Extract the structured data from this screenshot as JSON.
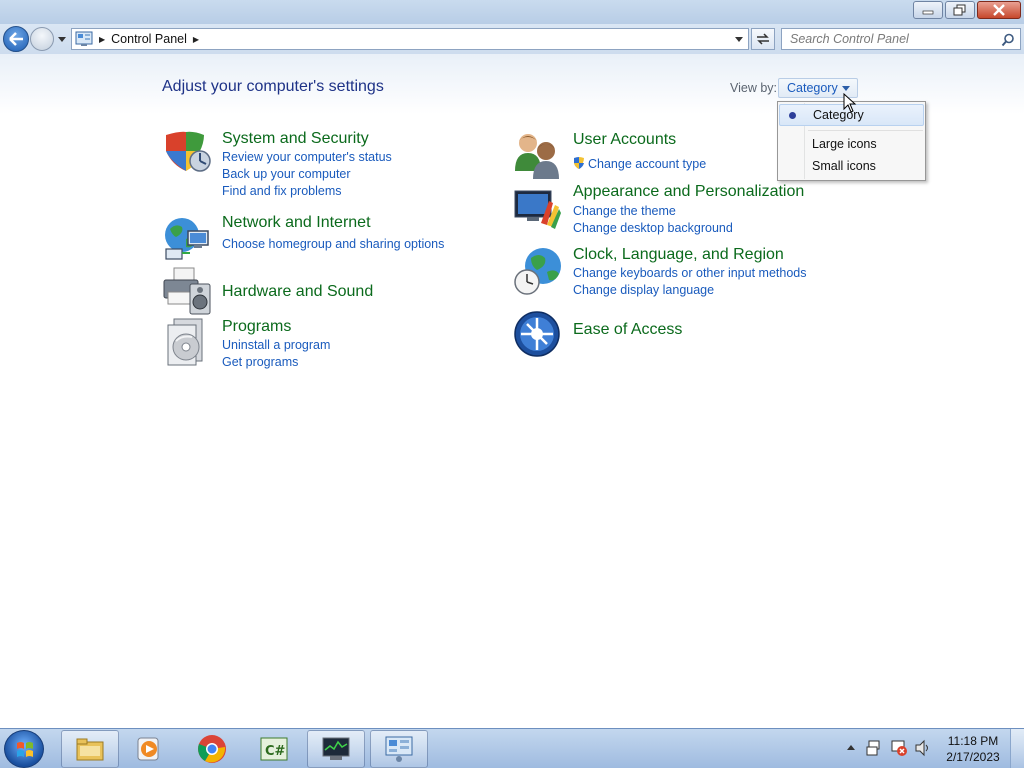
{
  "window": {
    "buttons": [
      "minimize",
      "restore",
      "close"
    ]
  },
  "address": {
    "breadcrumb": "Control Panel",
    "search_placeholder": "Search Control Panel"
  },
  "main": {
    "title": "Adjust your computer's settings",
    "view_by_label": "View by:",
    "view_by_value": "Category"
  },
  "categories": [
    {
      "title": "System and Security",
      "icon": "shield-icon",
      "links": [
        "Review your computer's status",
        "Back up your computer",
        "Find and fix problems"
      ]
    },
    {
      "title": "Network and Internet",
      "icon": "globe-network-icon",
      "links": [
        "Choose homegroup and sharing options"
      ]
    },
    {
      "title": "Hardware and Sound",
      "icon": "printer-speaker-icon",
      "links": []
    },
    {
      "title": "Programs",
      "icon": "programs-disc-icon",
      "links": [
        "Uninstall a program",
        "Get programs"
      ]
    },
    {
      "title": "User Accounts",
      "icon": "users-icon",
      "links": [
        "Change account type"
      ]
    },
    {
      "title": "Appearance and Personalization",
      "icon": "monitor-paint-icon",
      "links": [
        "Change the theme",
        "Change desktop background"
      ]
    },
    {
      "title": "Clock, Language, and Region",
      "icon": "globe-clock-icon",
      "links": [
        "Change keyboards or other input methods",
        "Change display language"
      ]
    },
    {
      "title": "Ease of Access",
      "icon": "ease-of-access-icon",
      "links": []
    }
  ],
  "view_menu": {
    "items": [
      "Category",
      "Large icons",
      "Small icons"
    ],
    "selected": "Category"
  },
  "taskbar": {
    "apps": [
      "file-explorer",
      "media-player",
      "chrome",
      "csharp-editor",
      "task-manager",
      "control-panel"
    ],
    "time": "11:18 PM",
    "date": "2/17/2023"
  },
  "colors": {
    "category_title": "#0b6a1c",
    "link": "#1a5bbd",
    "page_title": "#1e3287"
  }
}
